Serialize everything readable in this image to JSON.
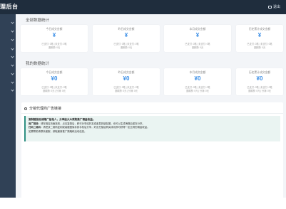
{
  "header": {
    "brand": "理后台",
    "logout_label": "退出"
  },
  "sidebar": {
    "items": [
      {
        "icon": "chevron-down-icon"
      },
      {
        "icon": "chevron-down-icon"
      },
      {
        "icon": "chevron-down-icon"
      },
      {
        "icon": "chevron-down-icon"
      },
      {
        "icon": "chevron-down-icon"
      },
      {
        "icon": "chevron-down-icon"
      },
      {
        "icon": "chevron-down-icon"
      },
      {
        "icon": "chevron-down-icon"
      },
      {
        "icon": "chevron-down-icon"
      }
    ]
  },
  "all": {
    "title": "全部数据统计",
    "cards": [
      {
        "name": "今日成交金额",
        "value": "¥",
        "sub1": "已支付: 0笔 | 未支付: 0笔",
        "sub2": "退款额: 0元"
      },
      {
        "name": "昨日成交金额",
        "value": "¥",
        "sub1": "已支付: 0笔 | 未支付: 0笔",
        "sub2": "退款额: 0元"
      },
      {
        "name": "本月成交金额",
        "value": "¥",
        "sub1": "已支付: 0笔 | 未支付: 0笔",
        "sub2": "退款额: 0元"
      },
      {
        "name": "历史累计成交金额",
        "value": "¥",
        "sub1": "已支付: 0笔 | 未支付: 0笔",
        "sub2": "退款额: 0元"
      }
    ]
  },
  "mine": {
    "title": "我的数据统计",
    "cards": [
      {
        "name": "今日成交金额",
        "value": "¥0",
        "sub1": "已支付: 0笔 | 未支付: 0笔",
        "sub2": "退款额: 0元 | 分润: 0元"
      },
      {
        "name": "昨日成交金额",
        "value": "¥0",
        "sub1": "已支付: 0笔 | 未支付: 0笔",
        "sub2": "退款额: 0元 | 分润: 0元"
      },
      {
        "name": "本月成交金额",
        "value": "¥0",
        "sub1": "已支付: 0笔 | 未支付: 0笔",
        "sub2": "退款额: 0元 | 分润: 0元"
      },
      {
        "name": "历史累计成交金额",
        "value": "¥0",
        "sub1": "已支付: 0笔 | 未支付: 0笔",
        "sub2": "退款额: 0元 | 分润: 0元"
      }
    ]
  },
  "notice": {
    "title": "分销代理商广告链接",
    "tip_title": "复制链接后请推广给他人，分享给大众获取推广佣金收益。",
    "line1_label": "推广链接：",
    "line1_text": "请在相应页面找到，点击复制后，即可分享给好友或者发到朋友圈，也可以生成海报后保存分享。",
    "line2_label": "扫码二维码：",
    "line2_text": "请把该二维码复制或者截图保存到手机后分享，好友扫描后购买成功即可获得一定比例的佣金收益。",
    "line3_text": "如需帮助请联系客服，获取最新推广策略和活动信息。"
  },
  "colors": {
    "topbar": "#1f2d3d",
    "sidebar": "#304156",
    "accent": "#3a8ee6",
    "tip_border": "#2f8f83"
  }
}
